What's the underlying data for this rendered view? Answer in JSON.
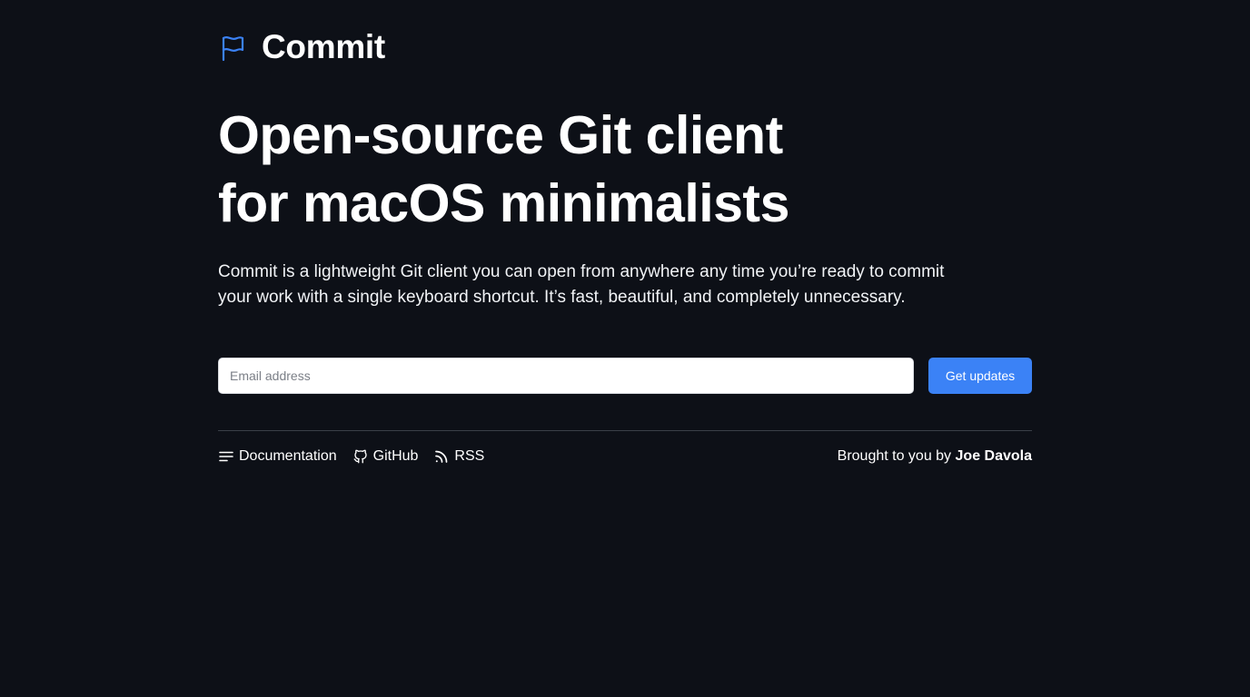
{
  "brand": {
    "name": "Commit",
    "icon": "flag-icon",
    "accent_color": "#3b82f6"
  },
  "hero": {
    "headline_line1": "Open-source Git client",
    "headline_line2": "for macOS minimalists",
    "lead": "Commit is a lightweight Git client you can open from anywhere any time you’re ready to commit your work with a single keyboard shortcut. It’s fast, beautiful, and completely unnecessary."
  },
  "signup": {
    "email_placeholder": "Email address",
    "email_value": "",
    "button_label": "Get updates"
  },
  "footer": {
    "links": [
      {
        "label": "Documentation",
        "icon": "lines-icon"
      },
      {
        "label": "GitHub",
        "icon": "github-icon"
      },
      {
        "label": "RSS",
        "icon": "rss-icon"
      }
    ],
    "credit_prefix": "Brought to you by",
    "credit_name": "Joe Davola"
  },
  "colors": {
    "background": "#0d1017",
    "button": "#3b82f6",
    "divider": "#3a3f48"
  }
}
